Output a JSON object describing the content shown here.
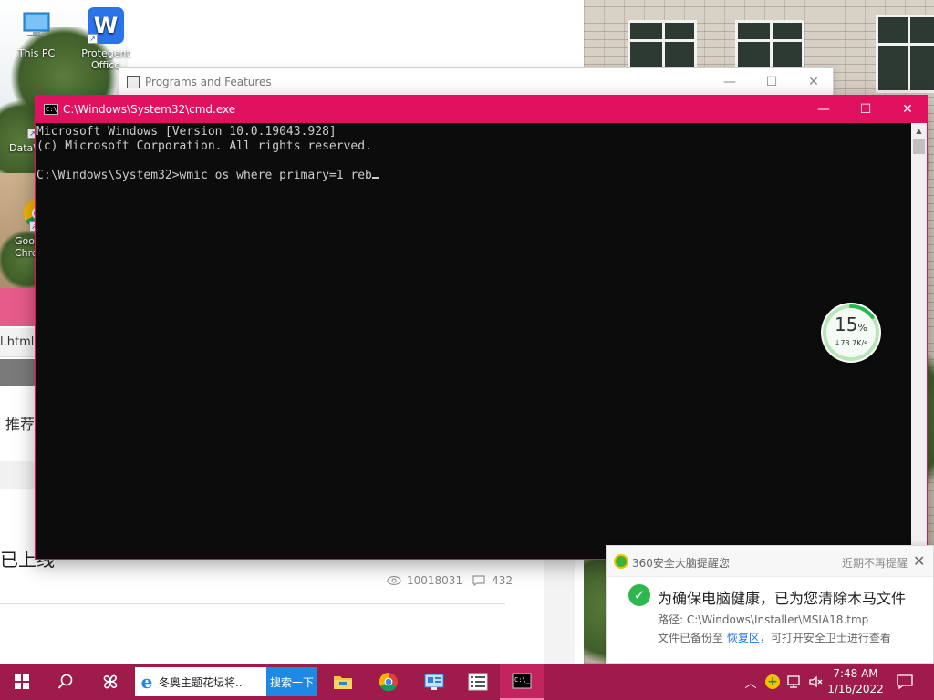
{
  "desktop": {
    "icons": [
      {
        "label": "This PC",
        "icon": "computer-icon"
      },
      {
        "label": "Protegent Office",
        "icon": "wps-office-icon",
        "glyph": "W"
      },
      {
        "label": "DataW",
        "icon": "app-shortcut-icon"
      },
      {
        "label": "Goo Chro",
        "icon": "chrome-icon"
      }
    ]
  },
  "background_page": {
    "url_fragment": "l.html",
    "text_fragment_1": "推荐",
    "text_fragment_2": "已上线",
    "views": "10018031",
    "comments": "432"
  },
  "programs_window": {
    "title": "Programs and Features",
    "controls": [
      "minimize",
      "maximize",
      "close"
    ]
  },
  "cmd": {
    "title": "C:\\Windows\\System32\\cmd.exe",
    "app_icon_text": "C:\\",
    "lines": [
      "Microsoft Windows [Version 10.0.19043.928]",
      "(c) Microsoft Corporation. All rights reserved.",
      "",
      "C:\\Windows\\System32>wmic os where primary=1 reb"
    ],
    "accent_color": "#e0115f"
  },
  "net_ball": {
    "percent": "15",
    "percent_sign": "%",
    "speed": "↓73.7K/s",
    "progress_fraction": 0.15
  },
  "notification": {
    "app_name": "360安全大脑提醒您",
    "mute_label": "近期不再提醒",
    "message": "为确保电脑健康，已为您清除木马文件",
    "path_label": "路径:",
    "path_value": "C:\\Windows\\Installer\\MSIA18.tmp",
    "backup_prefix": "文件已备份至",
    "backup_link": "恢复区",
    "backup_suffix": "，可打开安全卫士进行查看"
  },
  "taskbar": {
    "search_text": "冬奥主题花坛将...",
    "search_button": "搜索一下",
    "time": "7:48 AM",
    "date": "1/16/2022",
    "accent_color": "#9e1b4c",
    "apps": [
      "file-explorer-icon",
      "chrome-icon",
      "control-panel-icon",
      "programs-list-icon",
      "cmd-icon"
    ]
  }
}
